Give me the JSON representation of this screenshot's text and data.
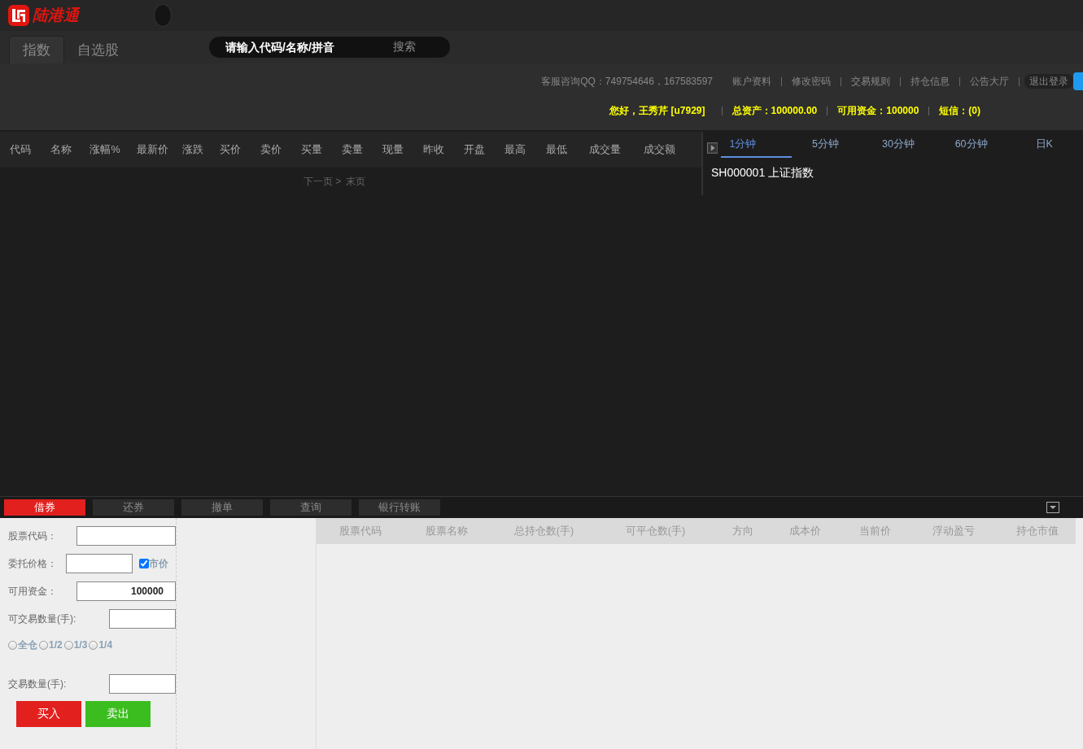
{
  "app": {
    "logo_text": "陆港通"
  },
  "nav_tabs": [
    {
      "label": "指数",
      "selected": true
    },
    {
      "label": "自选股",
      "selected": false
    }
  ],
  "search": {
    "placeholder": "请输入代码/名称/拼音",
    "button": "搜索"
  },
  "service_qq": "客服咨询QQ：749754646，167583597",
  "links": [
    "账户资料",
    "修改密码",
    "交易规则",
    "持仓信息",
    "公告大厅",
    "退出登录"
  ],
  "account": [
    "您好，王秀芹 [u7929]",
    "总资产：100000.00",
    "可用资金：100000",
    "短信：(0)"
  ],
  "quote_table": {
    "columns": [
      "代码",
      "名称",
      "涨幅%",
      "最新价",
      "涨跌",
      "买价",
      "卖价",
      "买量",
      "卖量",
      "现量",
      "昨收",
      "开盘",
      "最高",
      "最低",
      "成交量",
      "成交额"
    ],
    "pager": [
      "下一页 >",
      "末页"
    ]
  },
  "chart_panel": {
    "tabs": [
      {
        "label": "1分钟",
        "selected": true
      },
      {
        "label": "5分钟",
        "selected": false
      },
      {
        "label": "30分钟",
        "selected": false
      },
      {
        "label": "60分钟",
        "selected": false
      },
      {
        "label": "日K",
        "selected": false
      }
    ],
    "title": "SH000001 上证指数"
  },
  "trade_tabs": [
    {
      "label": "借券",
      "selected": true
    },
    {
      "label": "还券",
      "selected": false
    },
    {
      "label": "撤单",
      "selected": false
    },
    {
      "label": "查询",
      "selected": false
    },
    {
      "label": "银行转账",
      "selected": false
    }
  ],
  "order_form": {
    "fields": [
      {
        "label": "股票代码：",
        "kind": "wide"
      },
      {
        "label": "委托价格：",
        "kind": "price"
      },
      {
        "label": "可用资金：",
        "kind": "wide",
        "value": "100000"
      },
      {
        "label": "可交易数量(手):",
        "kind": "short"
      }
    ],
    "market_price": {
      "label": "市价",
      "checked": true
    },
    "ratios": [
      {
        "label": "全仓",
        "selected": false
      },
      {
        "label": "1/2",
        "selected": false
      },
      {
        "label": "1/3",
        "selected": false
      },
      {
        "label": "1/4",
        "selected": false
      }
    ],
    "quantity": {
      "label": "交易数量(手):"
    },
    "buttons": [
      {
        "label": "买入",
        "kind": "buy"
      },
      {
        "label": "卖出",
        "kind": "sell"
      }
    ]
  },
  "positions": {
    "columns": [
      "股票代码",
      "股票名称",
      "总持仓数(手)",
      "可平仓数(手)",
      "方向",
      "成本价",
      "当前价",
      "浮动盈亏",
      "持仓市值"
    ]
  }
}
